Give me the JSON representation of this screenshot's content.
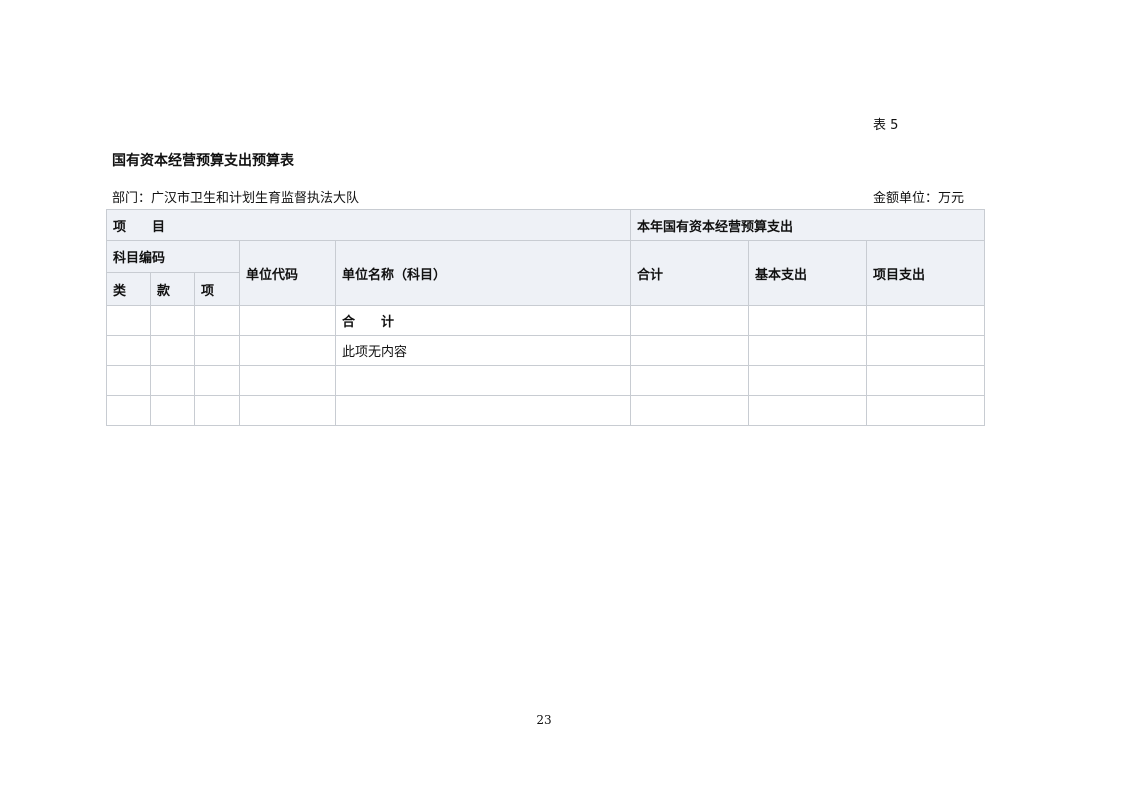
{
  "header": {
    "table_no": "表 5",
    "title": "国有资本经营预算支出预算表",
    "department": "部门：广汉市卫生和计划生育监督执法大队",
    "unit": "金额单位：万元"
  },
  "table": {
    "col_group_item": "项　　目",
    "col_group_budget": "本年国有资本经营预算支出",
    "col_subject_code": "科目编码",
    "col_class": "类",
    "col_section": "款",
    "col_item": "项",
    "col_unit_code": "单位代码",
    "col_unit_name": "单位名称（科目）",
    "col_total": "合计",
    "col_basic": "基本支出",
    "col_project": "项目支出",
    "rows": [
      {
        "class": "",
        "section": "",
        "item": "",
        "unit_code": "",
        "unit_name": "合　　计",
        "total": "",
        "basic": "",
        "project": ""
      },
      {
        "class": "",
        "section": "",
        "item": "",
        "unit_code": "",
        "unit_name": "此项无内容",
        "total": "",
        "basic": "",
        "project": ""
      },
      {
        "class": "",
        "section": "",
        "item": "",
        "unit_code": "",
        "unit_name": "",
        "total": "",
        "basic": "",
        "project": ""
      },
      {
        "class": "",
        "section": "",
        "item": "",
        "unit_code": "",
        "unit_name": "",
        "total": "",
        "basic": "",
        "project": ""
      }
    ]
  },
  "footer": {
    "page_number": "23"
  }
}
